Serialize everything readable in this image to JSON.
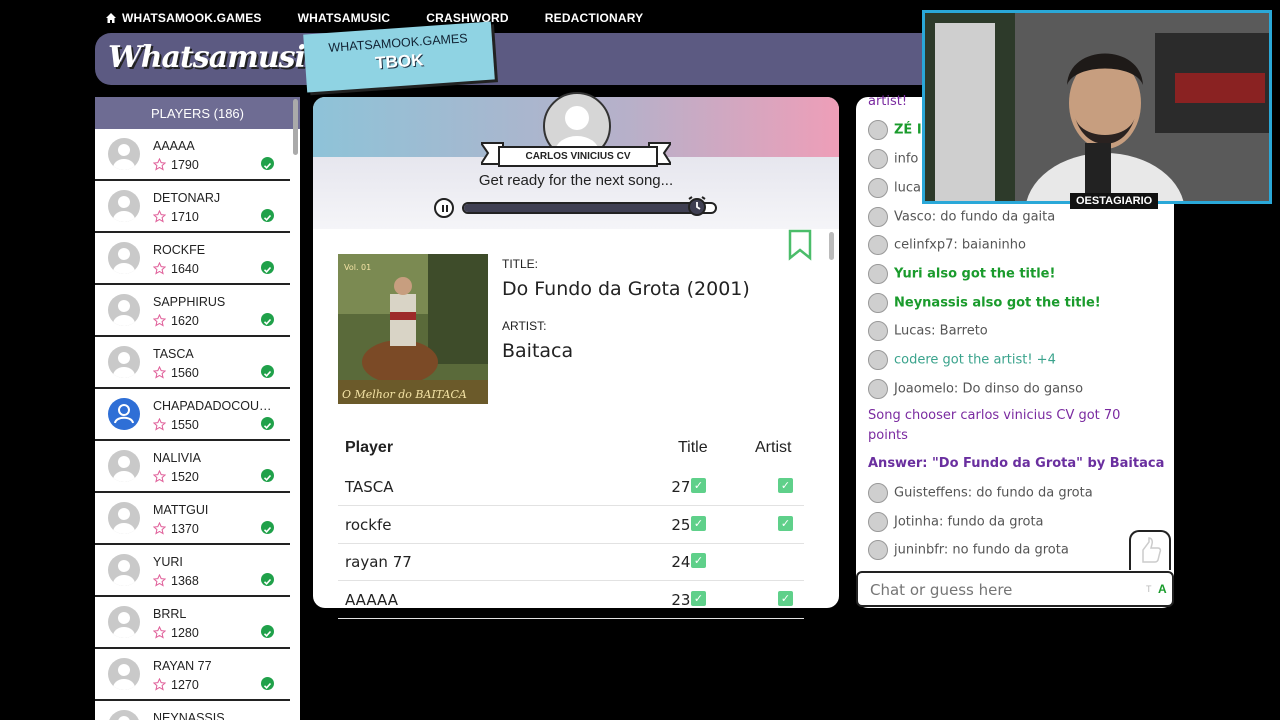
{
  "nav": {
    "home": "WHATSAMOOK.GAMES",
    "items": [
      "WHATSAMUSIC",
      "CRASHWORD",
      "REDACTIONARY"
    ]
  },
  "brand": {
    "logo": "Whatsamusic",
    "tag_sub": "WHATSAMOOK.GAMES",
    "tag_main": "TBOK"
  },
  "players": {
    "header": "PLAYERS (186)",
    "list": [
      {
        "name": "AAAAA",
        "score": "1790"
      },
      {
        "name": "DETONARJ",
        "score": "1710"
      },
      {
        "name": "ROCKFE",
        "score": "1640"
      },
      {
        "name": "SAPPHIRUS",
        "score": "1620"
      },
      {
        "name": "TASCA",
        "score": "1560"
      },
      {
        "name": "CHAPADADOCOUTI…",
        "score": "1550"
      },
      {
        "name": "NALIVIA",
        "score": "1520"
      },
      {
        "name": "MATTGUI",
        "score": "1370"
      },
      {
        "name": "YURI",
        "score": "1368"
      },
      {
        "name": "BRRL",
        "score": "1280"
      },
      {
        "name": "RAYAN 77",
        "score": "1270"
      },
      {
        "name": "NEYNASSIS",
        "score": ""
      }
    ]
  },
  "round": {
    "chooser": "CARLOS VINICIUS CV",
    "status": "Get ready for the next song...",
    "progress": 0.93,
    "title_label": "TITLE:",
    "title": "Do Fundo da Grota (2001)",
    "artist_label": "ARTIST:",
    "artist": "Baitaca",
    "cover_text": "O Melhor do BAITACA",
    "cover_vol": "Vol. 01"
  },
  "results": {
    "headers": [
      "Player",
      "Title",
      "Artist"
    ],
    "rows": [
      {
        "player": "TASCA",
        "score": "270",
        "artist": true
      },
      {
        "player": "rockfe",
        "score": "250",
        "artist": true
      },
      {
        "player": "rayan 77",
        "score": "240",
        "artist": false
      },
      {
        "player": "AAAAA",
        "score": "230",
        "artist": true
      }
    ]
  },
  "chat": {
    "messages": [
      {
        "text": "artist!",
        "style": "purple",
        "avatar": false
      },
      {
        "text": "ZÉ I",
        "style": "green",
        "avatar": true
      },
      {
        "text": "info",
        "style": "normal",
        "avatar": true
      },
      {
        "text": "luca",
        "style": "normal",
        "avatar": true
      },
      {
        "text": "Vasco: do fundo da gaita",
        "style": "normal",
        "avatar": true
      },
      {
        "text": "celinfxp7: baianinho",
        "style": "normal",
        "avatar": true
      },
      {
        "text": "Yuri also got the title!",
        "style": "green",
        "avatar": true
      },
      {
        "text": "Neynassis also got the title!",
        "style": "green",
        "avatar": true
      },
      {
        "text": "Lucas: Barreto",
        "style": "normal",
        "avatar": true
      },
      {
        "text": "codere got the artist! +4",
        "style": "teal",
        "avatar": true
      },
      {
        "text": "Joaomelo: Do dinso do ganso",
        "style": "normal",
        "avatar": true
      },
      {
        "text": "Song chooser carlos vinicius CV got 70",
        "style": "purple",
        "avatar": false
      },
      {
        "text": "points",
        "style": "purple",
        "avatar": false
      },
      {
        "text": "Answer: \"Do Fundo da Grota\" by Baitaca",
        "style": "purpleb",
        "avatar": false
      },
      {
        "text": "Guisteffens: do fundo da grota",
        "style": "normal",
        "avatar": true
      },
      {
        "text": "Jotinha: fundo da grota",
        "style": "normal",
        "avatar": true
      },
      {
        "text": "juninbfr: no fundo da grota",
        "style": "normal",
        "avatar": true
      }
    ],
    "placeholder": "Chat or guess here",
    "badge": "A"
  },
  "webcam": {
    "label": "OESTAGIARIO"
  },
  "colors": {
    "banner": "#5c5a82",
    "tag": "#8fd3e3",
    "green": "#20a14a",
    "purple": "#7a2aa0"
  }
}
